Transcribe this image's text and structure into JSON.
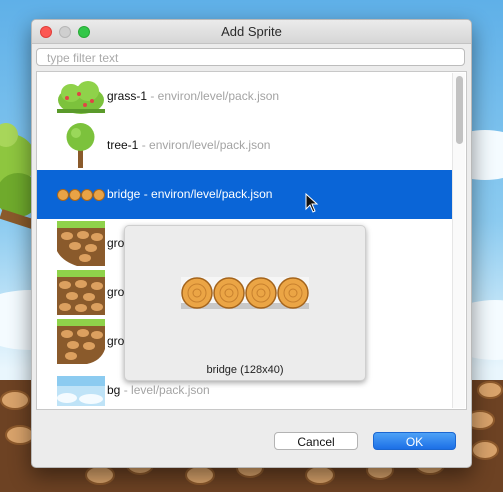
{
  "window": {
    "title": "Add Sprite"
  },
  "filter": {
    "placeholder": "type filter text"
  },
  "items": [
    {
      "name": "grass-1",
      "path": " - environ/level/pack.json",
      "icon": "bush-sprite-icon",
      "selected": false
    },
    {
      "name": "tree-1",
      "path": " - environ/level/pack.json",
      "icon": "tree-sprite-icon",
      "selected": false
    },
    {
      "name": "bridge",
      "path": " - environ/level/pack.json",
      "icon": "bridge-sprite-icon",
      "selected": true
    },
    {
      "name": "gro",
      "path": "",
      "icon": "ground-sprite-icon",
      "selected": false
    },
    {
      "name": "gro",
      "path": "",
      "icon": "ground-sprite-icon",
      "selected": false
    },
    {
      "name": "gro",
      "path": "",
      "icon": "ground-slope-sprite-icon",
      "selected": false
    },
    {
      "name": "bg",
      "path": " - level/pack.json",
      "icon": "sky-background-sprite-icon",
      "selected": false
    }
  ],
  "preview": {
    "caption": "bridge (128x40)"
  },
  "buttons": {
    "cancel": "Cancel",
    "ok": "OK"
  },
  "colors": {
    "selection": "#0a65d7",
    "ok_button": "#1c6fe6",
    "close": "#fc5753",
    "maximize": "#33c748"
  }
}
